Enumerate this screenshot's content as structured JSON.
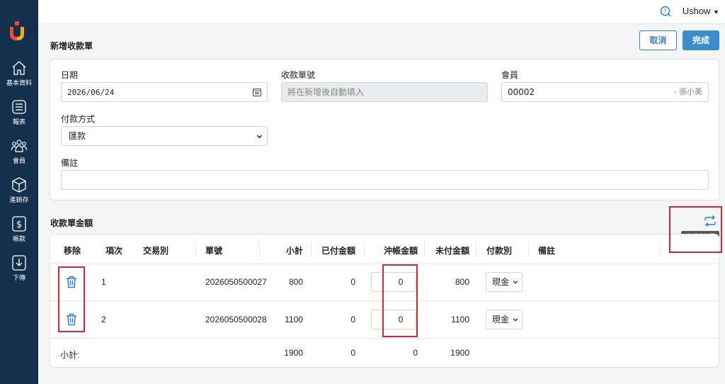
{
  "header": {
    "user_name": "Ushow"
  },
  "sidebar": {
    "items": [
      {
        "label": "基本資料",
        "icon": "home-icon"
      },
      {
        "label": "報表",
        "icon": "report-icon"
      },
      {
        "label": "會員",
        "icon": "members-icon"
      },
      {
        "label": "進銷存",
        "icon": "inventory-box-icon"
      },
      {
        "label": "帳款",
        "icon": "dollar-icon"
      },
      {
        "label": "下傳",
        "icon": "download-icon"
      }
    ]
  },
  "page": {
    "title": "新增收款單",
    "cancel_label": "取消",
    "done_label": "完成"
  },
  "form": {
    "date_label": "日期",
    "date_value": "2026/06/24",
    "receipt_no_label": "收款單號",
    "receipt_no_placeholder": "將在新增後自動填入",
    "member_label": "會員",
    "member_code": "00002",
    "member_name": "- 張小美",
    "payment_label": "付款方式",
    "payment_value": "匯款",
    "note_label": "備註",
    "note_value": ""
  },
  "amount_section": {
    "title": "收款單金額",
    "auto_offset_tooltip": "自動沖帳",
    "columns": [
      "移除",
      "項次",
      "交易別",
      "單號",
      "小計",
      "已付金額",
      "沖帳金額",
      "未付金額",
      "付款別",
      "備註"
    ],
    "rows": [
      {
        "index": "1",
        "type": "",
        "order_no": "2026050500027",
        "subtotal": "800",
        "paid": "0",
        "offset": "0",
        "unpaid": "800",
        "pay_type": "現金",
        "note": ""
      },
      {
        "index": "2",
        "type": "",
        "order_no": "2026050500028",
        "subtotal": "1100",
        "paid": "0",
        "offset": "0",
        "unpaid": "1100",
        "pay_type": "現金",
        "note": ""
      }
    ],
    "totals": {
      "label": "小計:",
      "subtotal": "1900",
      "paid": "0",
      "offset": "0",
      "unpaid": "1900"
    }
  },
  "colors": {
    "sidebar_bg": "#13304d",
    "primary": "#3c8dcb",
    "highlight_red": "#d9262e"
  }
}
